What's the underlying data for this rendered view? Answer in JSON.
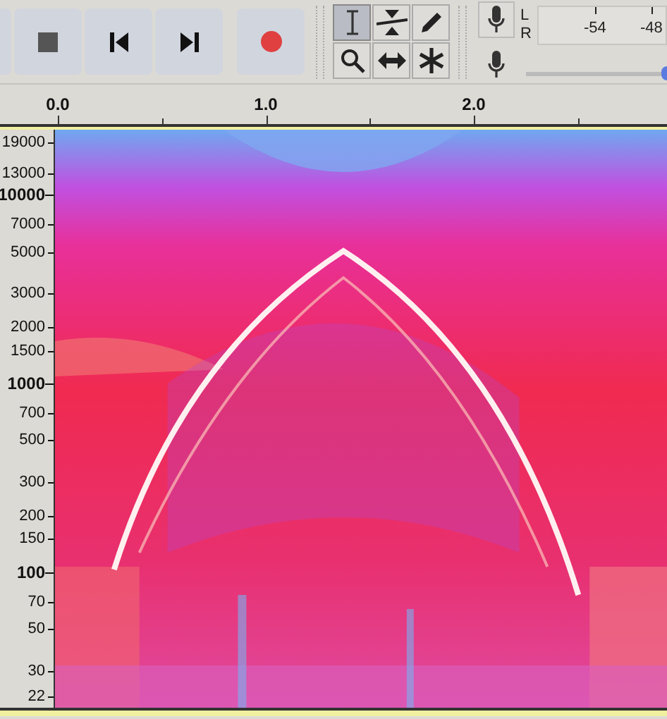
{
  "transport": [
    {
      "kind": "partial"
    },
    {
      "kind": "stop"
    },
    {
      "kind": "skip-start"
    },
    {
      "kind": "skip-end"
    },
    {
      "kind": "record"
    }
  ],
  "tools": [
    {
      "kind": "select",
      "selected": true
    },
    {
      "kind": "envelope",
      "selected": false
    },
    {
      "kind": "draw",
      "selected": false
    },
    {
      "kind": "zoom",
      "selected": false
    },
    {
      "kind": "time-shift",
      "selected": false
    },
    {
      "kind": "multi",
      "selected": false
    }
  ],
  "meter": {
    "channels": [
      "L",
      "R"
    ],
    "scale": [
      "-54",
      "-48"
    ]
  },
  "input_volume": {
    "level": 1.0
  },
  "ruler": {
    "labels": [
      "0.0",
      "1.0",
      "2.0"
    ]
  },
  "frequency_axis": {
    "labels": [
      {
        "text": "19000",
        "emphasized": false
      },
      {
        "text": "13000",
        "emphasized": false
      },
      {
        "text": "10000",
        "emphasized": true
      },
      {
        "text": "7000",
        "emphasized": false
      },
      {
        "text": "5000",
        "emphasized": false
      },
      {
        "text": "3000",
        "emphasized": false
      },
      {
        "text": "2000",
        "emphasized": false
      },
      {
        "text": "1500",
        "emphasized": false
      },
      {
        "text": "1000",
        "emphasized": true
      },
      {
        "text": "700",
        "emphasized": false
      },
      {
        "text": "500",
        "emphasized": false
      },
      {
        "text": "300",
        "emphasized": false
      },
      {
        "text": "200",
        "emphasized": false
      },
      {
        "text": "150",
        "emphasized": false
      },
      {
        "text": "100",
        "emphasized": true
      },
      {
        "text": "70",
        "emphasized": false
      },
      {
        "text": "50",
        "emphasized": false
      },
      {
        "text": "30",
        "emphasized": false
      },
      {
        "text": "22",
        "emphasized": false
      }
    ]
  }
}
